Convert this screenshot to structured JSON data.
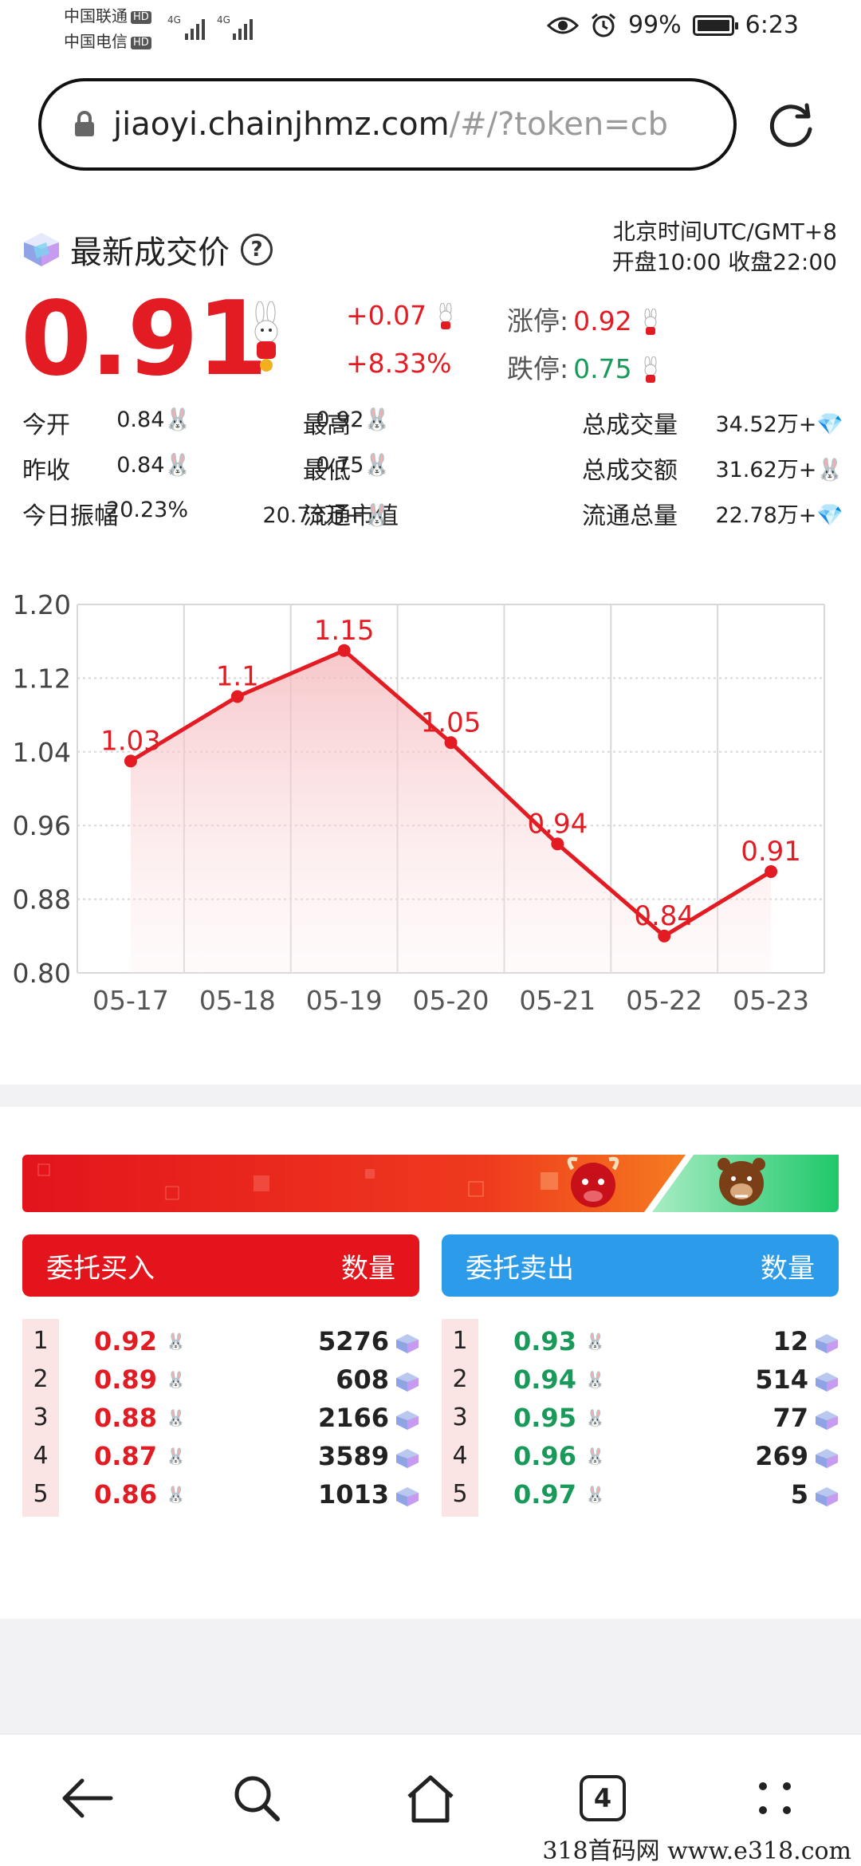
{
  "status_bar": {
    "carrier1": "中国联通",
    "carrier2": "中国电信",
    "hd_badge": "HD",
    "net1": "4G",
    "net2": "4G",
    "battery": "99%",
    "time": "6:23"
  },
  "browser": {
    "url_main": "jiaoyi.chainjhmz.com",
    "url_rest": "/#/?token=cb"
  },
  "header": {
    "title": "最新成交价",
    "timezone": "北京时间UTC/GMT+8",
    "hours": "开盘10:00 收盘22:00"
  },
  "price": {
    "last": "0.91",
    "change_abs": "+0.07",
    "change_pct": "+8.33%",
    "limit_up_label": "涨停:",
    "limit_up_value": "0.92",
    "limit_down_label": "跌停:",
    "limit_down_value": "0.75"
  },
  "stats": [
    {
      "l1": "今开",
      "v1": "0.84",
      "l2": "最高",
      "v2": "0.92",
      "l3": "总成交量",
      "v3": "34.52万+"
    },
    {
      "l1": "昨收",
      "v1": "0.84",
      "l2": "最低",
      "v2": "0.75",
      "l3": "总成交额",
      "v3": "31.62万+"
    },
    {
      "l1": "今日振幅",
      "v1": "20.23%",
      "l2": "流通市值",
      "v2": "20.73万+",
      "l3": "流通总量",
      "v3": "22.78万+"
    }
  ],
  "chart_data": {
    "type": "area",
    "categories": [
      "05-17",
      "05-18",
      "05-19",
      "05-20",
      "05-21",
      "05-22",
      "05-23"
    ],
    "values": [
      1.03,
      1.1,
      1.15,
      1.05,
      0.94,
      0.84,
      0.91
    ],
    "y_ticks": [
      "1.20",
      "1.12",
      "1.04",
      "0.96",
      "0.88",
      "0.80"
    ],
    "ylim": [
      0.8,
      1.2
    ],
    "grid": true,
    "line_color": "#e31b23"
  },
  "orderbook": {
    "buy_title": "委托买入",
    "sell_title": "委托卖出",
    "qty_label": "数量",
    "buy": [
      {
        "idx": "1",
        "price": "0.92",
        "qty": "5276"
      },
      {
        "idx": "2",
        "price": "0.89",
        "qty": "608"
      },
      {
        "idx": "3",
        "price": "0.88",
        "qty": "2166"
      },
      {
        "idx": "4",
        "price": "0.87",
        "qty": "3589"
      },
      {
        "idx": "5",
        "price": "0.86",
        "qty": "1013"
      }
    ],
    "sell": [
      {
        "idx": "1",
        "price": "0.93",
        "qty": "12"
      },
      {
        "idx": "2",
        "price": "0.94",
        "qty": "514"
      },
      {
        "idx": "3",
        "price": "0.95",
        "qty": "77"
      },
      {
        "idx": "4",
        "price": "0.96",
        "qty": "269"
      },
      {
        "idx": "5",
        "price": "0.97",
        "qty": "5"
      }
    ]
  },
  "nav": {
    "tab_count": "4"
  },
  "watermark": "318首码网 www.e318.com",
  "colors": {
    "up": "#e31b23",
    "down": "#1a9a5a",
    "sell_header": "#2b9bea",
    "buy_header": "#e3141c"
  }
}
